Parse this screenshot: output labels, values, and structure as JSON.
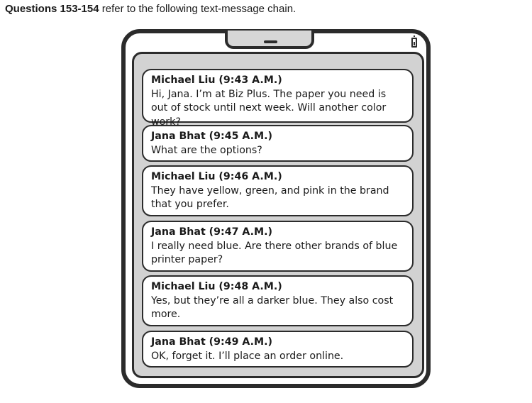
{
  "intro": {
    "question_numbers": "Questions 153-154",
    "text": " refer to the following text-message chain."
  },
  "messages": [
    {
      "sender": "Michael Liu (9:43 A.M.)",
      "text": "Hi, Jana. I’m at Biz Plus. The paper you need is out of stock until next week. Will another color work?"
    },
    {
      "sender": "Jana Bhat (9:45 A.M.)",
      "text": "What are the options?"
    },
    {
      "sender": "Michael Liu (9:46 A.M.)",
      "text": "They have yellow, green, and pink in the brand that you prefer."
    },
    {
      "sender": "Jana Bhat (9:47 A.M.)",
      "text": "I really need blue. Are there other brands of blue printer paper?"
    },
    {
      "sender": "Michael Liu (9:48 A.M.)",
      "text": "Yes, but they’re all a darker blue. They also cost more."
    },
    {
      "sender": "Jana Bhat (9:49 A.M.)",
      "text": "OK, forget it. I’ll place an order online."
    }
  ],
  "icons": {
    "battery": "battery-icon"
  }
}
